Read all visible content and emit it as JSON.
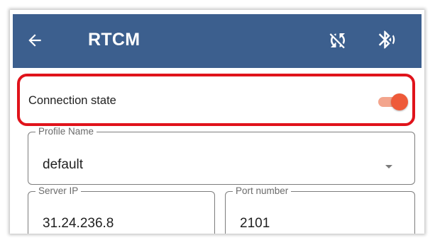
{
  "appbar": {
    "title": "RTCM",
    "back_icon": "arrow-left-icon",
    "sync_icon": "sync-disabled-icon",
    "bluetooth_icon": "bluetooth-searching-icon",
    "background_color": "#3c5f8e"
  },
  "connection": {
    "label": "Connection state",
    "toggle_on": true,
    "toggle_color": "#ee5a39",
    "highlight_color": "#e0131b"
  },
  "profile": {
    "label": "Profile Name",
    "value": "default"
  },
  "server": {
    "ip_label": "Server IP",
    "ip_value": "31.24.236.8",
    "port_label": "Port number",
    "port_value": "2101"
  }
}
